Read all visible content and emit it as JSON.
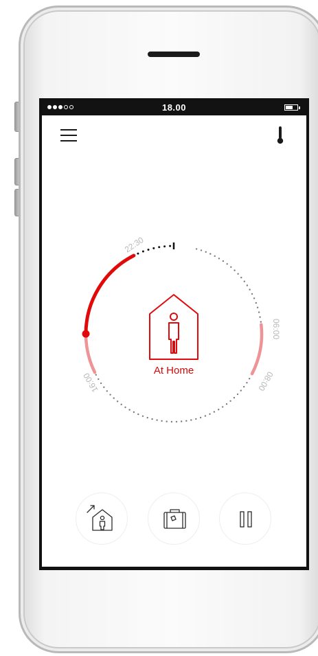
{
  "status_bar": {
    "time": "18.00",
    "signal_filled": 3,
    "signal_total": 5,
    "battery_level": 0.6
  },
  "header": {
    "menu_icon": "hamburger-menu-icon",
    "thermostat_icon": "thermometer-icon"
  },
  "dial": {
    "mode_label": "At Home",
    "mode_icon": "house-person-icon",
    "time_labels": {
      "t2230": "22:30",
      "t0600": "06:00",
      "t0800": "08:00",
      "t1600": "16:00"
    }
  },
  "actions": [
    {
      "name": "home-mode",
      "icon": "house-arrow-icon"
    },
    {
      "name": "away-mode",
      "icon": "suitcase-icon"
    },
    {
      "name": "pause",
      "icon": "pause-icon"
    }
  ],
  "colors": {
    "accent": "#e10a0a",
    "accent_light": "#ee9396",
    "dots": "#7a7a7a",
    "label_gray": "#b8b8b8"
  }
}
